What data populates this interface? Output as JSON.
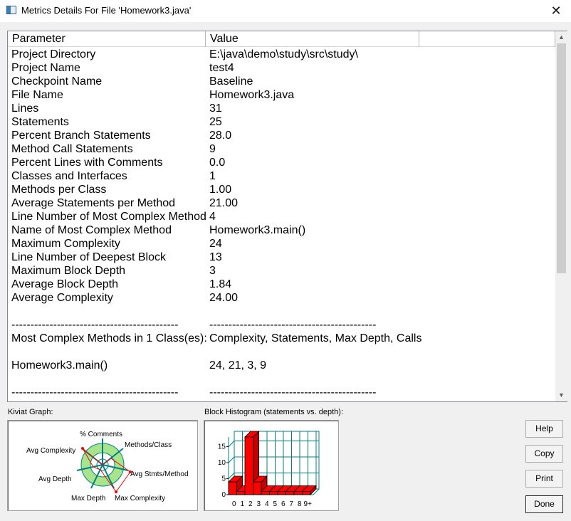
{
  "window": {
    "title": "Metrics Details For File 'Homework3.java'",
    "close_glyph": "✕"
  },
  "table": {
    "columns": [
      "Parameter",
      "Value"
    ],
    "rows": [
      [
        "Project Directory",
        "E:\\java\\demo\\study\\src\\study\\"
      ],
      [
        "Project Name",
        "test4"
      ],
      [
        "Checkpoint Name",
        "Baseline"
      ],
      [
        "File Name",
        "Homework3.java"
      ],
      [
        "Lines",
        "31"
      ],
      [
        "Statements",
        "25"
      ],
      [
        "Percent Branch Statements",
        "28.0"
      ],
      [
        "Method Call Statements",
        "9"
      ],
      [
        "Percent Lines with Comments",
        "0.0"
      ],
      [
        "Classes and Interfaces",
        "1"
      ],
      [
        "Methods per Class",
        "1.00"
      ],
      [
        "Average Statements per Method",
        "21.00"
      ],
      [
        "Line Number of Most Complex Method",
        "4"
      ],
      [
        "Name of Most Complex Method",
        "Homework3.main()"
      ],
      [
        "Maximum Complexity",
        "24"
      ],
      [
        "Line Number of Deepest Block",
        "13"
      ],
      [
        "Maximum Block Depth",
        "3"
      ],
      [
        "Average Block Depth",
        "1.84"
      ],
      [
        "Average Complexity",
        "24.00"
      ],
      [
        "",
        ""
      ],
      [
        "--------------------------------------------",
        "--------------------------------------------"
      ],
      [
        "Most Complex Methods in 1 Class(es):",
        "Complexity, Statements, Max Depth, Calls"
      ],
      [
        "",
        ""
      ],
      [
        "Homework3.main()",
        "24, 21, 3, 9"
      ],
      [
        "",
        ""
      ],
      [
        "--------------------------------------------",
        "--------------------------------------------"
      ]
    ]
  },
  "kiviat": {
    "label": "Kiviat Graph:",
    "axes": [
      "% Comments",
      "Methods/Class",
      "Avg Stmts/Method",
      "Max Complexity",
      "Max Depth",
      "Avg Depth",
      "Avg Complexity"
    ]
  },
  "histogram": {
    "label": "Block Histogram (statements vs. depth):",
    "y_ticks": [
      "0",
      "5",
      "10",
      "15"
    ],
    "x_ticks": [
      "0",
      "1",
      "2",
      "3",
      "4",
      "5",
      "6",
      "7",
      "8",
      "9+"
    ],
    "values": [
      4,
      1,
      18,
      4,
      1,
      1,
      1,
      1,
      1,
      1
    ],
    "ylim": [
      0,
      18
    ],
    "bar_color": "#ff0000",
    "grid_color": "#008080"
  },
  "buttons": {
    "help": "Help",
    "copy": "Copy",
    "print": "Print",
    "done": "Done"
  },
  "scrollbar": {
    "up": "▲",
    "down": "▼"
  }
}
